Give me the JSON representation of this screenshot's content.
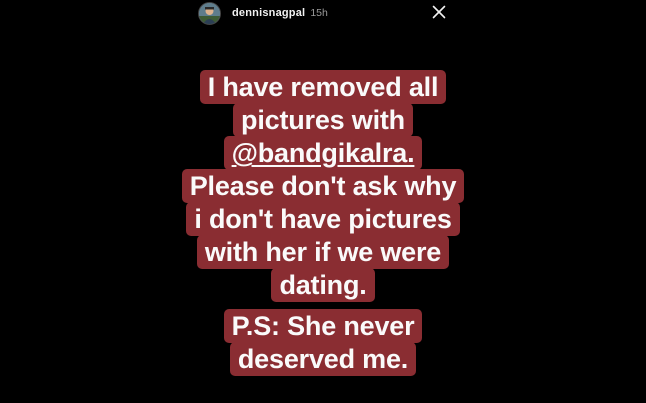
{
  "header": {
    "username": "dennisnagpal",
    "timestamp": "15h",
    "close_icon": "close-icon",
    "avatar_icon": "profile-avatar"
  },
  "story": {
    "background_color": "#000000",
    "highlight_color": "#8a2d32",
    "text_color": "#fafafa",
    "lines": [
      "I have removed all",
      "pictures with",
      "@bandgikalra.",
      "Please don't ask why",
      "i don't have pictures",
      "with her if we were",
      "dating."
    ],
    "ps_lines": [
      "P.S: She never",
      "deserved me."
    ]
  }
}
